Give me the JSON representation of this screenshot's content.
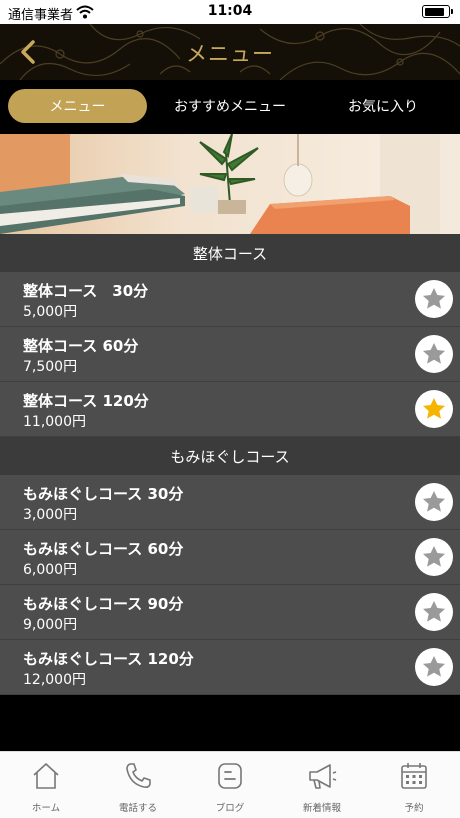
{
  "status_bar": {
    "carrier": "通信事業者",
    "time": "11:04",
    "battery_level": 0.9
  },
  "header": {
    "title": "メニュー",
    "back_icon": "chevron-left-icon"
  },
  "tabs": [
    {
      "label": "メニュー",
      "active": true
    },
    {
      "label": "おすすめメニュー",
      "active": false
    },
    {
      "label": "お気に入り",
      "active": false
    }
  ],
  "sections": [
    {
      "title": "整体コース",
      "items": [
        {
          "name": "整体コース　30分",
          "price": "5,000円",
          "favorite": false
        },
        {
          "name": "整体コース 60分",
          "price": "7,500円",
          "favorite": false
        },
        {
          "name": "整体コース 120分",
          "price": "11,000円",
          "favorite": true
        }
      ]
    },
    {
      "title": "もみほぐしコース",
      "items": [
        {
          "name": "もみほぐしコース 30分",
          "price": "3,000円",
          "favorite": false
        },
        {
          "name": "もみほぐしコース 60分",
          "price": "6,000円",
          "favorite": false
        },
        {
          "name": "もみほぐしコース 90分",
          "price": "9,000円",
          "favorite": false
        },
        {
          "name": "もみほぐしコース 120分",
          "price": "12,000円",
          "favorite": false
        }
      ]
    }
  ],
  "tabbar": [
    {
      "label": "ホーム",
      "icon": "home-icon"
    },
    {
      "label": "電話する",
      "icon": "phone-icon"
    },
    {
      "label": "ブログ",
      "icon": "blog-icon"
    },
    {
      "label": "新着情報",
      "icon": "megaphone-icon"
    },
    {
      "label": "予約",
      "icon": "calendar-icon"
    }
  ],
  "colors": {
    "accent_gold": "#c2a255",
    "title_gold": "#c8a95c",
    "star_active": "#f5b400",
    "star_inactive": "#9a9a9a",
    "row_bg": "#4d4d4d",
    "section_bg": "#3b3b3b"
  }
}
